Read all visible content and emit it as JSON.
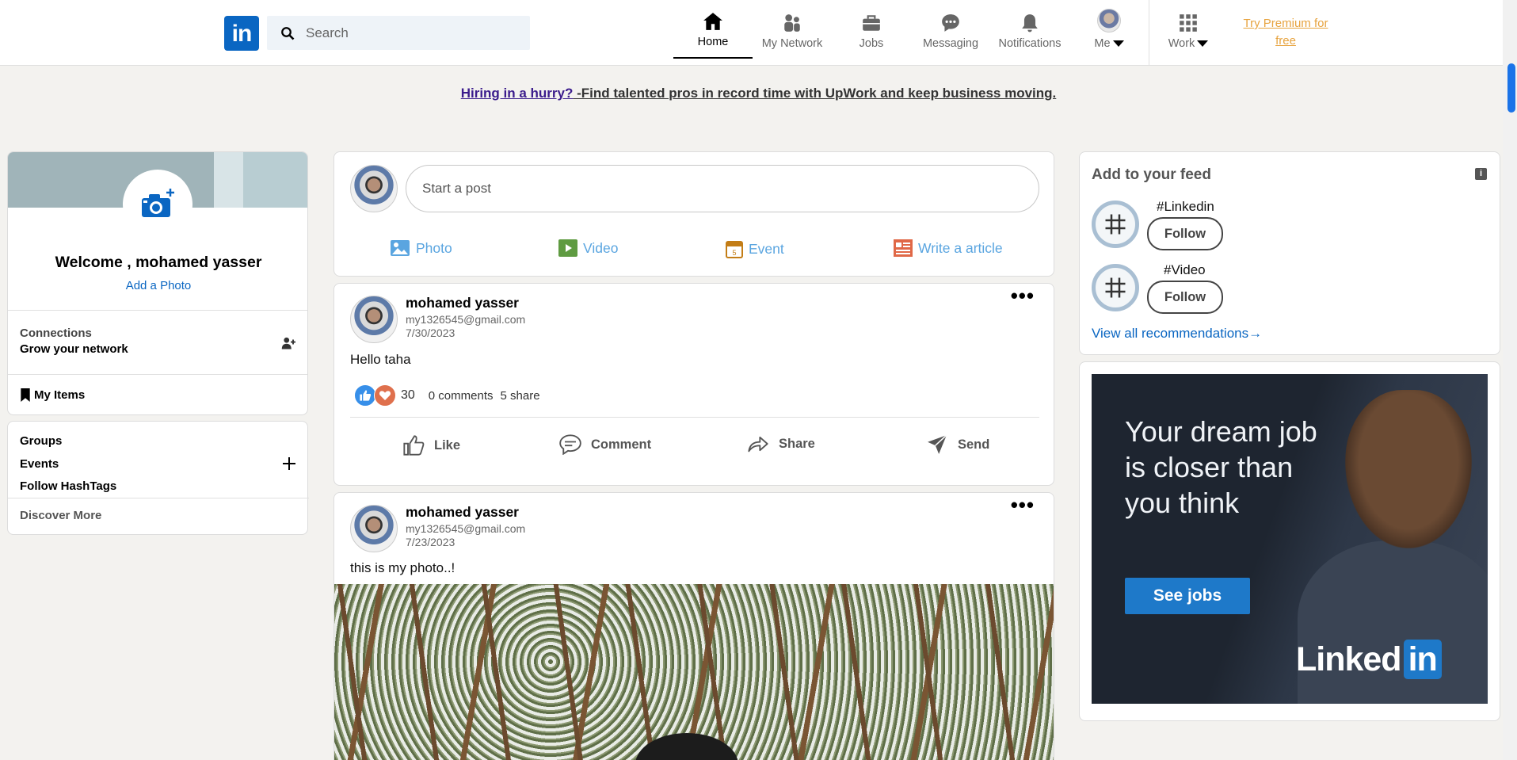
{
  "header": {
    "logo_text": "in",
    "search_placeholder": "Search",
    "nav": [
      {
        "label": "Home",
        "icon": "home-icon"
      },
      {
        "label": "My Network",
        "icon": "network-icon"
      },
      {
        "label": "Jobs",
        "icon": "briefcase-icon"
      },
      {
        "label": "Messaging",
        "icon": "message-icon"
      },
      {
        "label": "Notifications",
        "icon": "bell-icon"
      },
      {
        "label": "Me",
        "icon": "avatar"
      },
      {
        "label": "Work",
        "icon": "grid-icon"
      }
    ],
    "premium": "Try Premium for free"
  },
  "banner": {
    "link": "Hiring in a hurry?",
    "text": " -Find talented pros in record time with UpWork and keep business moving."
  },
  "left": {
    "welcome": "Welcome , mohamed yasser",
    "add_photo": "Add a Photo",
    "connections": "Connections",
    "grow": "Grow your network",
    "my_items": "My Items",
    "groups": "Groups",
    "events": "Events",
    "hashtags": "Follow HashTags",
    "discover": "Discover More"
  },
  "composer": {
    "placeholder": "Start a post",
    "actions": [
      "Photo",
      "Video",
      "Event",
      "Write a article"
    ]
  },
  "posts": [
    {
      "name": "mohamed yasser",
      "email": "my1326545@gmail.com",
      "date": "7/30/2023",
      "text": "Hello taha",
      "reactions": "30",
      "comments": "0 comments",
      "shares": "5 share"
    },
    {
      "name": "mohamed yasser",
      "email": "my1326545@gmail.com",
      "date": "7/23/2023",
      "text": "this is my photo..!"
    }
  ],
  "post_actions": [
    "Like",
    "Comment",
    "Share",
    "Send"
  ],
  "right": {
    "feed_title": "Add to your feed",
    "hashtags": [
      {
        "name": "#Linkedin",
        "button": "Follow"
      },
      {
        "name": "#Video",
        "button": "Follow"
      }
    ],
    "view_all": "View all recommendations",
    "ad": {
      "headline": "Your dream job is closer than you think",
      "button": "See jobs",
      "logo_word": "Linked",
      "logo_in": "in"
    }
  },
  "colors": {
    "brand": "#0a66c2",
    "premium": "#e7a33e",
    "action_blue": "#5aa5e0"
  }
}
